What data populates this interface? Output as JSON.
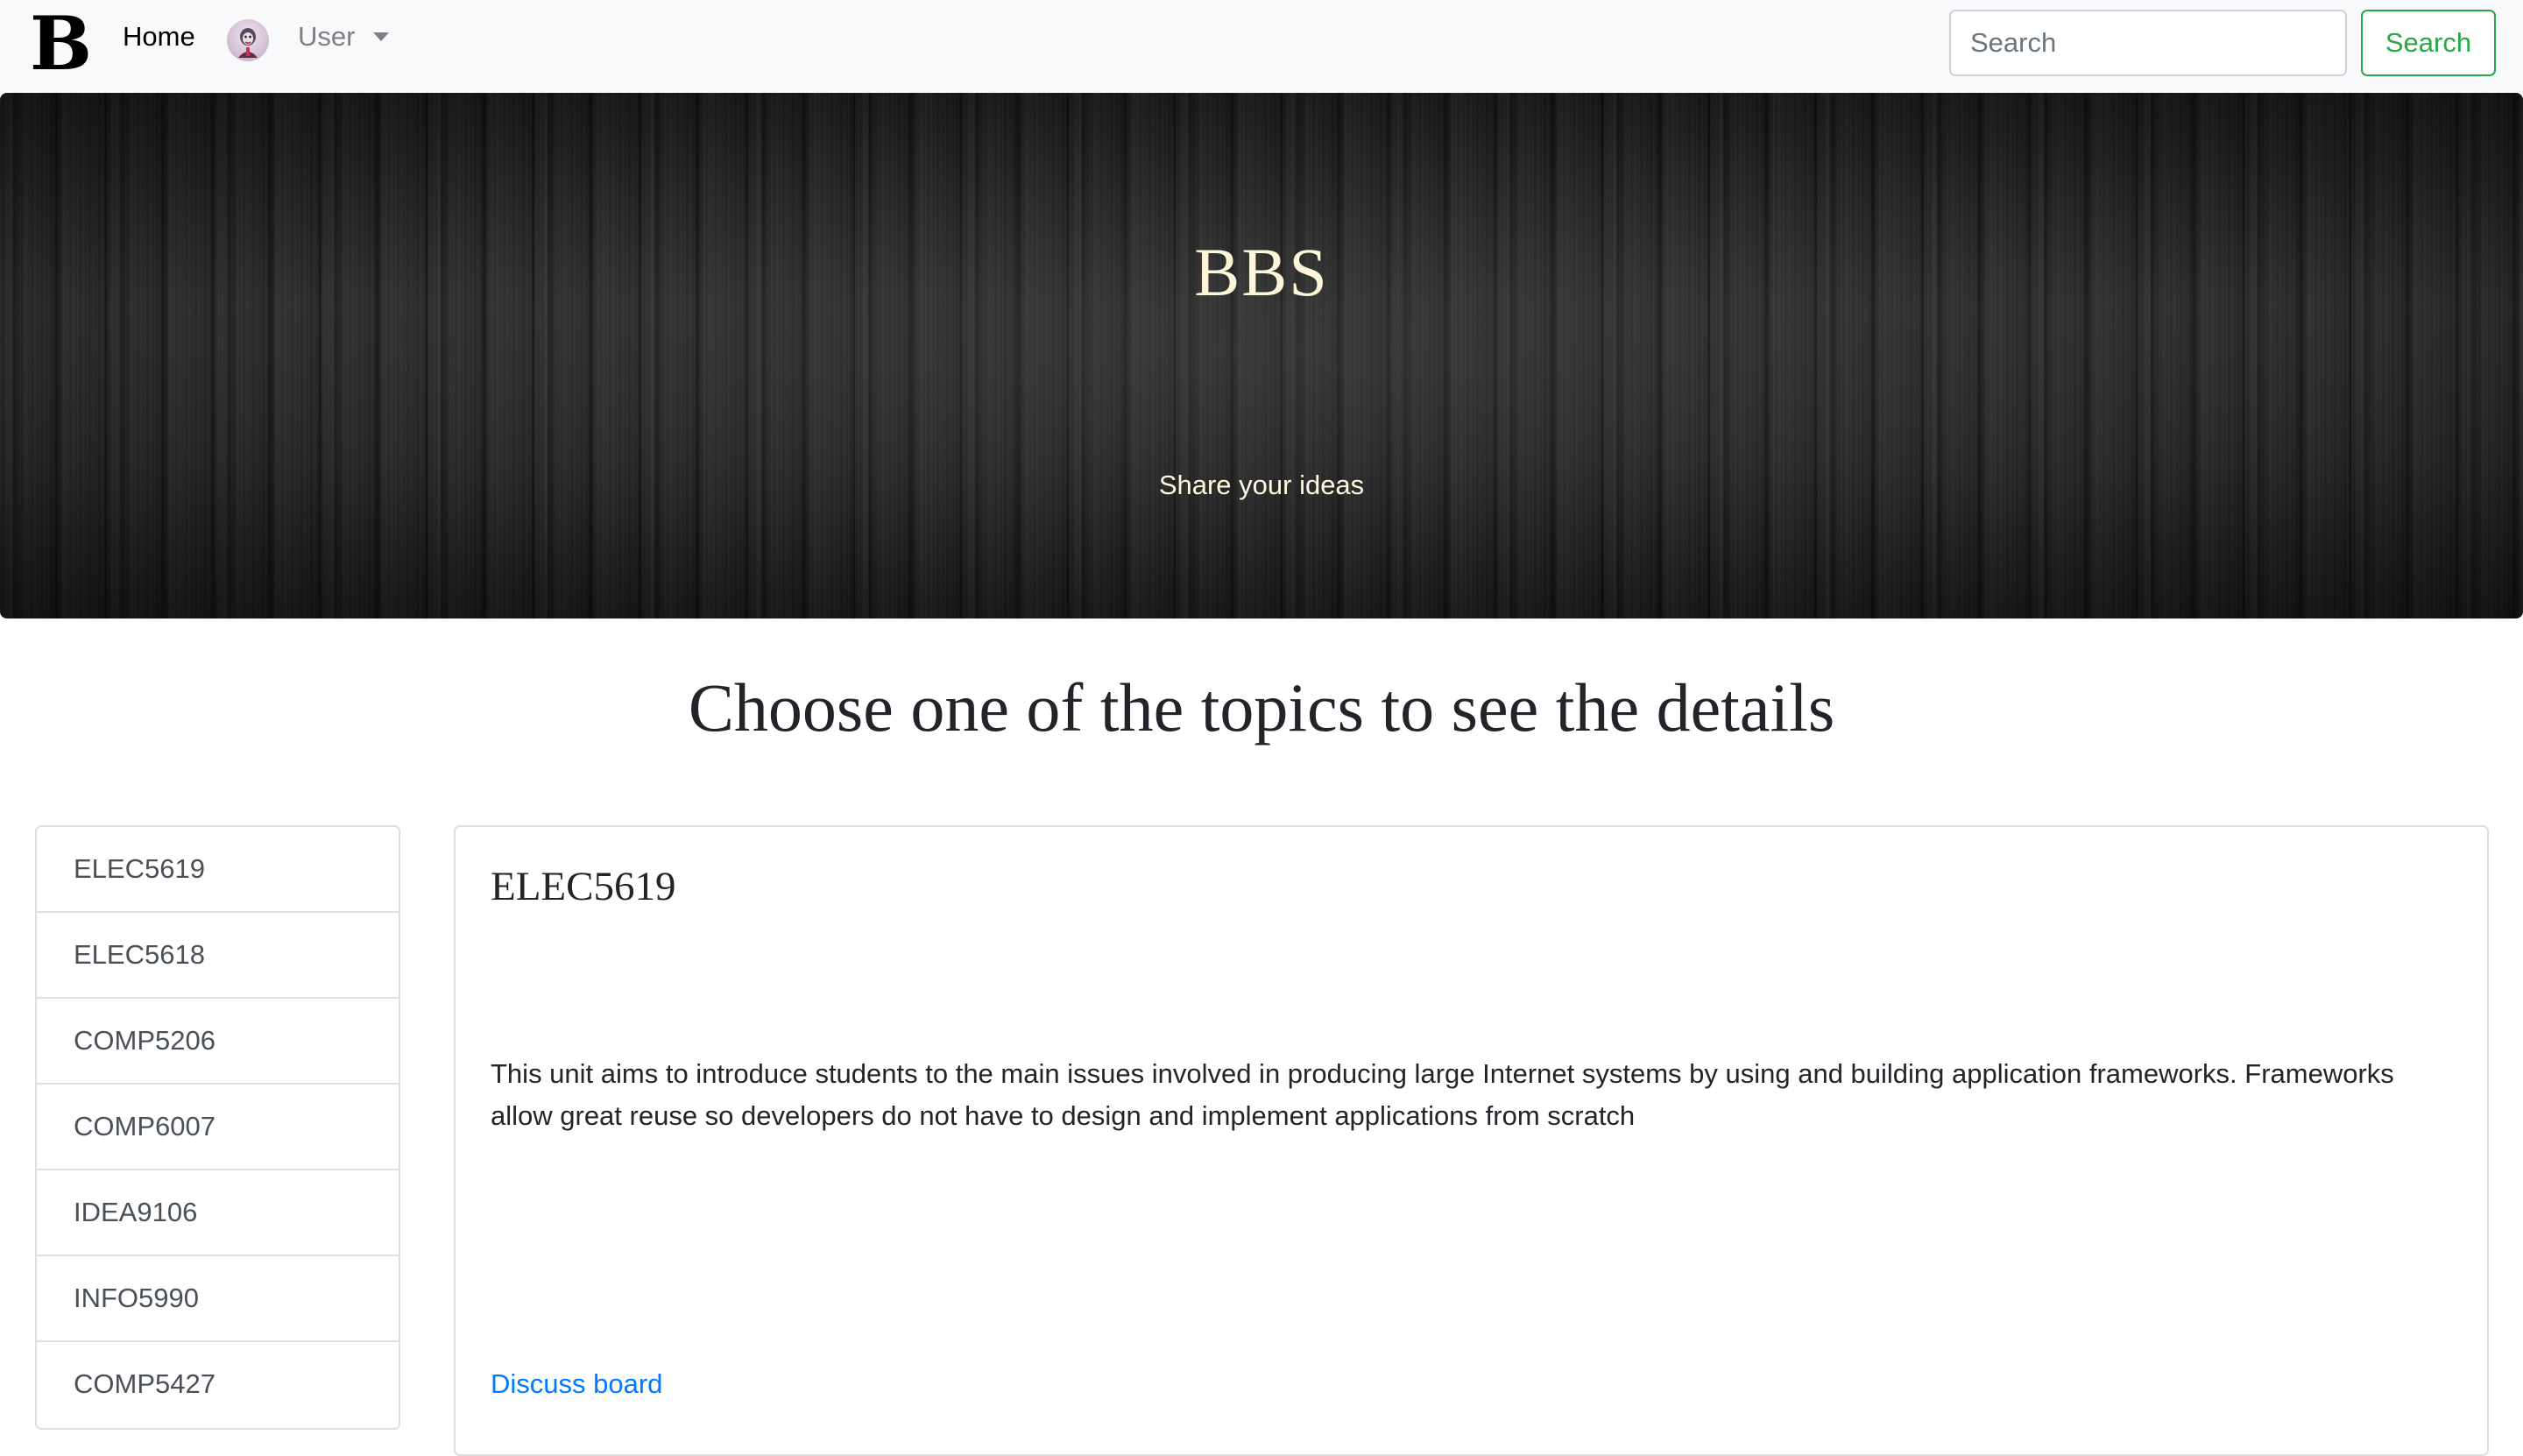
{
  "navbar": {
    "brand_letter": "B",
    "home_label": "Home",
    "user_label": "User",
    "search_placeholder": "Search",
    "search_button_label": "Search"
  },
  "hero": {
    "title": "BBS",
    "subtitle": "Share your ideas"
  },
  "page_heading": "Choose one of the topics to see the details",
  "topics": [
    {
      "label": "ELEC5619"
    },
    {
      "label": "ELEC5618"
    },
    {
      "label": "COMP5206"
    },
    {
      "label": "COMP6007"
    },
    {
      "label": "IDEA9106"
    },
    {
      "label": "INFO5990"
    },
    {
      "label": "COMP5427"
    }
  ],
  "detail": {
    "title": "ELEC5619",
    "description": "This unit aims to introduce students to the main issues involved in producing large Internet systems by using and building application frameworks. Frameworks allow great reuse so developers do not have to design and implement applications from scratch",
    "link_label": "Discuss board"
  },
  "colors": {
    "navbar_bg": "#f8f9fa",
    "search_button": "#28a745",
    "link": "#007bff",
    "hero_text": "#fdf6d8"
  },
  "icons": {
    "avatar": "user-avatar-icon",
    "caret": "caret-down-icon"
  }
}
